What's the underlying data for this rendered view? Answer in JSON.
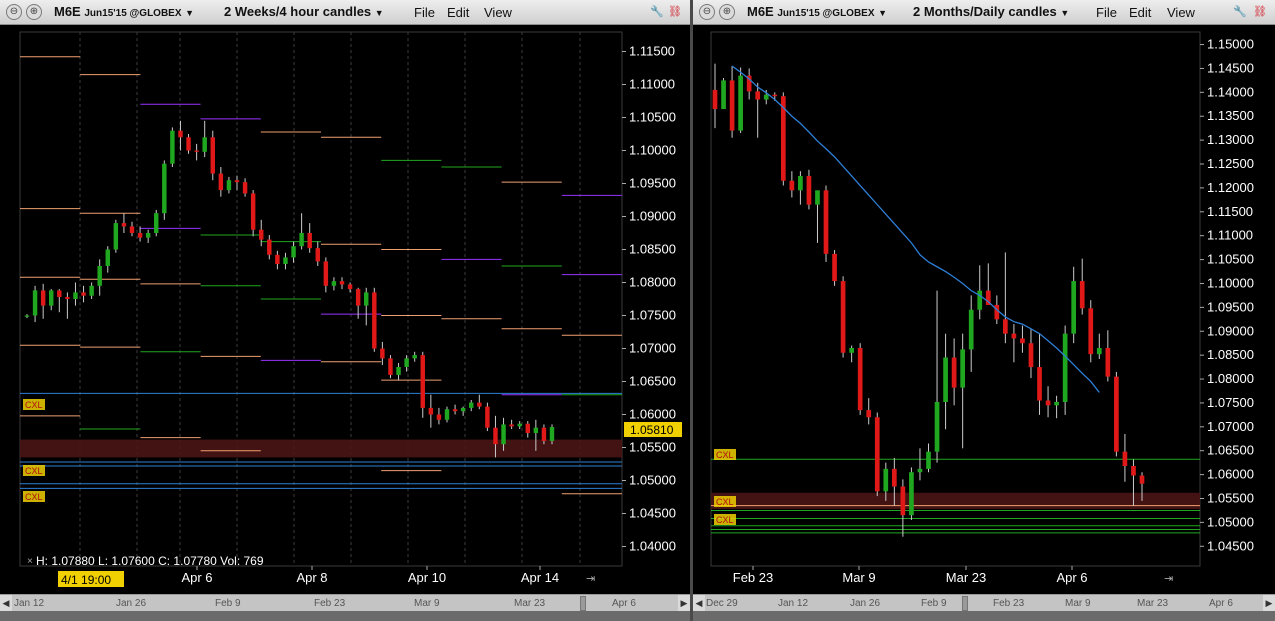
{
  "left": {
    "symbol": "M6E",
    "contract": "Jun15'15 @GLOBEX",
    "timeframe": "2 Weeks/4 hour candles",
    "menu": [
      "File",
      "Edit",
      "View"
    ],
    "price_labels": [
      "1.11500",
      "1.11000",
      "1.10500",
      "1.10000",
      "1.09500",
      "1.09000",
      "1.08500",
      "1.08000",
      "1.07500",
      "1.07000",
      "1.06500",
      "1.06000",
      "1.05500",
      "1.05000",
      "1.04500",
      "1.04000"
    ],
    "current_price": "1.05810",
    "date_labels": [
      "Apr 6",
      "Apr 8",
      "Apr 10",
      "Apr 14"
    ],
    "cursor_date": "4/1 19:00",
    "hlcv": "H: 1.07880   L: 1.07600   C: 1.07780   Vol: 769",
    "cxl": [
      "CXL",
      "CXL",
      "CXL"
    ],
    "scroll_labels": [
      "Jan 12",
      "Jan 26",
      "Feb 9",
      "Feb 23",
      "Mar 9",
      "Mar 23",
      "Apr 6"
    ]
  },
  "right": {
    "symbol": "M6E",
    "contract": "Jun15'15 @GLOBEX",
    "timeframe": "2 Months/Daily candles",
    "menu": [
      "File",
      "Edit",
      "View"
    ],
    "price_labels": [
      "1.15000",
      "1.14500",
      "1.14000",
      "1.13500",
      "1.13000",
      "1.12500",
      "1.12000",
      "1.11500",
      "1.11000",
      "1.10500",
      "1.10000",
      "1.09500",
      "1.09000",
      "1.08500",
      "1.08000",
      "1.07500",
      "1.07000",
      "1.06500",
      "1.06000",
      "1.05500",
      "1.05000",
      "1.04500"
    ],
    "date_labels": [
      "Feb 23",
      "Mar 9",
      "Mar 23",
      "Apr 6"
    ],
    "cxl": [
      "CXL",
      "CXL",
      "CXL"
    ],
    "scroll_labels": [
      "Dec 29",
      "Jan 12",
      "Jan 26",
      "Feb 9",
      "Feb 23",
      "Mar 9",
      "Mar 23",
      "Apr 6"
    ]
  },
  "colors": {
    "up": "#1fa81f",
    "down": "#e01818",
    "moving_average": "#2e7fd6",
    "accent": "#f0d000",
    "background": "#000000"
  },
  "chart_data": [
    {
      "type": "candlestick",
      "title": "M6E Jun15'15 @GLOBEX 2 Weeks/4 hour candles",
      "ylim": [
        1.0375,
        1.1175
      ],
      "x_tick_labels": [
        "Apr 6",
        "Apr 8",
        "Apr 10",
        "Apr 14"
      ],
      "last_price": 1.0581,
      "candles": [
        [
          1.0748,
          1.0752,
          1.0746,
          1.075
        ],
        [
          1.075,
          1.0795,
          1.074,
          1.0788
        ],
        [
          1.0788,
          1.0798,
          1.0745,
          1.0765
        ],
        [
          1.0765,
          1.079,
          1.0758,
          1.0788
        ],
        [
          1.0788,
          1.079,
          1.0755,
          1.0778
        ],
        [
          1.0778,
          1.0785,
          1.0745,
          1.0775
        ],
        [
          1.0775,
          1.08,
          1.0765,
          1.0785
        ],
        [
          1.0785,
          1.0795,
          1.077,
          1.078
        ],
        [
          1.078,
          1.08,
          1.0775,
          1.0795
        ],
        [
          1.0795,
          1.0835,
          1.078,
          1.0825
        ],
        [
          1.0825,
          1.0855,
          1.0815,
          1.085
        ],
        [
          1.085,
          1.0895,
          1.0845,
          1.089
        ],
        [
          1.089,
          1.0905,
          1.0875,
          1.0885
        ],
        [
          1.0885,
          1.0892,
          1.087,
          1.0875
        ],
        [
          1.0875,
          1.0885,
          1.0862,
          1.0868
        ],
        [
          1.0868,
          1.088,
          1.086,
          1.0875
        ],
        [
          1.0875,
          1.091,
          1.087,
          1.0905
        ],
        [
          1.0905,
          1.0985,
          1.0895,
          1.098
        ],
        [
          1.098,
          1.1035,
          1.0975,
          1.103
        ],
        [
          1.103,
          1.1045,
          1.1,
          1.102
        ],
        [
          1.102,
          1.1025,
          1.0995,
          1.1
        ],
        [
          1.1,
          1.101,
          1.0985,
          1.0998
        ],
        [
          1.0998,
          1.1045,
          1.099,
          1.102
        ],
        [
          1.102,
          1.103,
          1.0955,
          1.0965
        ],
        [
          1.0965,
          1.0975,
          1.093,
          1.094
        ],
        [
          1.094,
          1.096,
          1.0935,
          1.0955
        ],
        [
          1.0955,
          1.0962,
          1.094,
          1.0952
        ],
        [
          1.0952,
          1.0958,
          1.093,
          1.0935
        ],
        [
          1.0935,
          1.094,
          1.087,
          1.088
        ],
        [
          1.088,
          1.0895,
          1.0855,
          1.0865
        ],
        [
          1.0865,
          1.0872,
          1.0835,
          1.0842
        ],
        [
          1.0842,
          1.0848,
          1.082,
          1.0828
        ],
        [
          1.0828,
          1.0845,
          1.082,
          1.0838
        ],
        [
          1.0838,
          1.0862,
          1.083,
          1.0855
        ],
        [
          1.0855,
          1.0905,
          1.085,
          1.0875
        ],
        [
          1.0875,
          1.089,
          1.0845,
          1.0852
        ],
        [
          1.0852,
          1.0862,
          1.0825,
          1.0832
        ],
        [
          1.0832,
          1.0838,
          1.0785,
          1.0795
        ],
        [
          1.0795,
          1.0808,
          1.0788,
          1.0802
        ],
        [
          1.0802,
          1.0808,
          1.079,
          1.0797
        ],
        [
          1.0797,
          1.08,
          1.0785,
          1.079
        ],
        [
          1.079,
          1.0792,
          1.0745,
          1.0765
        ],
        [
          1.0765,
          1.0792,
          1.0735,
          1.0785
        ],
        [
          1.0785,
          1.0792,
          1.0695,
          1.07
        ],
        [
          1.07,
          1.071,
          1.0675,
          1.0685
        ],
        [
          1.0685,
          1.069,
          1.0655,
          1.066
        ],
        [
          1.066,
          1.0678,
          1.0652,
          1.0672
        ],
        [
          1.0672,
          1.069,
          1.0665,
          1.0685
        ],
        [
          1.0685,
          1.0695,
          1.068,
          1.069
        ],
        [
          1.069,
          1.0695,
          1.0595,
          1.061
        ],
        [
          1.061,
          1.063,
          1.058,
          1.06
        ],
        [
          1.06,
          1.061,
          1.0585,
          1.0592
        ],
        [
          1.0592,
          1.0612,
          1.0588,
          1.0608
        ],
        [
          1.0608,
          1.0615,
          1.06,
          1.0605
        ],
        [
          1.0605,
          1.0612,
          1.0598,
          1.061
        ],
        [
          1.061,
          1.0622,
          1.0605,
          1.0618
        ],
        [
          1.0618,
          1.063,
          1.0608,
          1.0612
        ],
        [
          1.0612,
          1.0618,
          1.0575,
          1.058
        ],
        [
          1.058,
          1.0598,
          1.0535,
          1.0555
        ],
        [
          1.0555,
          1.0595,
          1.0545,
          1.0585
        ],
        [
          1.0585,
          1.0592,
          1.0578,
          1.0582
        ],
        [
          1.0582,
          1.059,
          1.0578,
          1.0586
        ],
        [
          1.0586,
          1.059,
          1.0565,
          1.0572
        ],
        [
          1.0572,
          1.0592,
          1.0545,
          1.058
        ],
        [
          1.058,
          1.0585,
          1.0555,
          1.056
        ],
        [
          1.056,
          1.0585,
          1.0555,
          1.0581
        ]
      ],
      "level_lines": [
        {
          "price": 1.1142,
          "color": "#f0a070"
        },
        {
          "price": 1.1115,
          "color": "#f0a070"
        },
        {
          "price": 1.107,
          "color": "#9933ff"
        },
        {
          "price": 1.1048,
          "color": "#9933ff"
        },
        {
          "price": 1.1028,
          "color": "#f0a070"
        },
        {
          "price": 1.102,
          "color": "#f0a070"
        },
        {
          "price": 1.0985,
          "color": "#1fa81f"
        },
        {
          "price": 1.0975,
          "color": "#1fa81f"
        },
        {
          "price": 1.0952,
          "color": "#f0a070"
        },
        {
          "price": 1.0932,
          "color": "#9933ff"
        },
        {
          "price": 1.0912,
          "color": "#f0a070"
        },
        {
          "price": 1.0905,
          "color": "#f0a070"
        },
        {
          "price": 1.0882,
          "color": "#9933ff"
        },
        {
          "price": 1.0872,
          "color": "#1fa81f"
        },
        {
          "price": 1.0862,
          "color": "#1fa81f"
        },
        {
          "price": 1.0858,
          "color": "#f0a070"
        },
        {
          "price": 1.085,
          "color": "#f0a070"
        },
        {
          "price": 1.0835,
          "color": "#9933ff"
        },
        {
          "price": 1.0825,
          "color": "#1fa81f"
        },
        {
          "price": 1.0812,
          "color": "#9933ff"
        },
        {
          "price": 1.0808,
          "color": "#f0a070"
        },
        {
          "price": 1.0805,
          "color": "#f0a070"
        },
        {
          "price": 1.0798,
          "color": "#f0a070"
        },
        {
          "price": 1.0795,
          "color": "#1fa81f"
        },
        {
          "price": 1.0775,
          "color": "#1fa81f"
        },
        {
          "price": 1.0752,
          "color": "#9933ff"
        },
        {
          "price": 1.075,
          "color": "#f0a070"
        },
        {
          "price": 1.0745,
          "color": "#f0a070"
        },
        {
          "price": 1.073,
          "color": "#f0a070"
        },
        {
          "price": 1.072,
          "color": "#f0a070"
        },
        {
          "price": 1.0705,
          "color": "#f0a070"
        },
        {
          "price": 1.0702,
          "color": "#f0a070"
        },
        {
          "price": 1.0695,
          "color": "#1fa81f"
        },
        {
          "price": 1.0688,
          "color": "#f0a070"
        },
        {
          "price": 1.0682,
          "color": "#9933ff"
        },
        {
          "price": 1.068,
          "color": "#f0a070"
        },
        {
          "price": 1.0652,
          "color": "#f0a070"
        },
        {
          "price": 1.0632,
          "color": "#2e7fd6"
        },
        {
          "price": 1.063,
          "color": "#9933ff"
        },
        {
          "price": 1.063,
          "color": "#1fa81f"
        },
        {
          "price": 1.0598,
          "color": "#f0a070"
        },
        {
          "price": 1.0578,
          "color": "#1fa81f"
        },
        {
          "price": 1.0565,
          "color": "#f0a070"
        },
        {
          "price": 1.0545,
          "color": "#f0a070"
        },
        {
          "price": 1.0528,
          "color": "#2e7fd6"
        },
        {
          "price": 1.0522,
          "color": "#2e7fd6"
        },
        {
          "price": 1.0515,
          "color": "#f0a070"
        },
        {
          "price": 1.0495,
          "color": "#2e7fd6"
        },
        {
          "price": 1.0488,
          "color": "#2e7fd6"
        },
        {
          "price": 1.048,
          "color": "#f0a070"
        }
      ],
      "zone": [
        1.0535,
        1.0562
      ]
    },
    {
      "type": "candlestick",
      "title": "M6E Jun15'15 @GLOBEX 2 Months/Daily candles",
      "ylim": [
        1.0415,
        1.152
      ],
      "x_tick_labels": [
        "Feb 23",
        "Mar 9",
        "Mar 23",
        "Apr 6"
      ],
      "candles": [
        [
          1.1405,
          1.146,
          1.1325,
          1.1365
        ],
        [
          1.1365,
          1.143,
          1.1365,
          1.1425
        ],
        [
          1.1425,
          1.1455,
          1.1305,
          1.132
        ],
        [
          1.132,
          1.1452,
          1.1315,
          1.1435
        ],
        [
          1.1435,
          1.145,
          1.1385,
          1.1402
        ],
        [
          1.1402,
          1.142,
          1.1305,
          1.1385
        ],
        [
          1.1385,
          1.1405,
          1.1375,
          1.1395
        ],
        [
          1.1395,
          1.14,
          1.1382,
          1.1392
        ],
        [
          1.1392,
          1.14,
          1.1205,
          1.1215
        ],
        [
          1.1215,
          1.1235,
          1.118,
          1.1195
        ],
        [
          1.1195,
          1.1235,
          1.1165,
          1.1225
        ],
        [
          1.1225,
          1.1238,
          1.1155,
          1.1165
        ],
        [
          1.1165,
          1.119,
          1.1085,
          1.1195
        ],
        [
          1.1195,
          1.1205,
          1.1045,
          1.1062
        ],
        [
          1.1062,
          1.107,
          1.0995,
          1.1005
        ],
        [
          1.1005,
          1.1015,
          1.0845,
          1.0855
        ],
        [
          1.0855,
          1.087,
          1.0835,
          1.0865
        ],
        [
          1.0865,
          1.0875,
          1.0725,
          1.0735
        ],
        [
          1.0735,
          1.076,
          1.0705,
          1.072
        ],
        [
          1.072,
          1.073,
          1.0555,
          1.0565
        ],
        [
          1.0565,
          1.0625,
          1.0545,
          1.0612
        ],
        [
          1.0612,
          1.0635,
          1.0535,
          1.0575
        ],
        [
          1.0575,
          1.059,
          1.047,
          1.0515
        ],
        [
          1.0515,
          1.0615,
          1.0505,
          1.0605
        ],
        [
          1.0605,
          1.0655,
          1.0588,
          1.0612
        ],
        [
          1.0612,
          1.0665,
          1.0605,
          1.0648
        ],
        [
          1.0648,
          1.0985,
          1.0625,
          1.0752
        ],
        [
          1.0752,
          1.0895,
          1.0695,
          1.0845
        ],
        [
          1.0845,
          1.0885,
          1.0745,
          1.0782
        ],
        [
          1.0782,
          1.0895,
          1.0655,
          1.0862
        ],
        [
          1.0862,
          1.0975,
          1.0815,
          1.0945
        ],
        [
          1.0945,
          1.1038,
          1.0925,
          1.0985
        ],
        [
          1.0985,
          1.1042,
          1.0965,
          1.0955
        ],
        [
          1.0955,
          1.0975,
          1.0915,
          1.0925
        ],
        [
          1.0925,
          1.1065,
          1.0875,
          1.0895
        ],
        [
          1.0895,
          1.0915,
          1.0835,
          1.0885
        ],
        [
          1.0885,
          1.0912,
          1.0855,
          1.0875
        ],
        [
          1.0875,
          1.0905,
          1.0802,
          1.0825
        ],
        [
          1.0825,
          1.0895,
          1.0725,
          1.0755
        ],
        [
          1.0755,
          1.0785,
          1.072,
          1.0745
        ],
        [
          1.0745,
          1.0765,
          1.0718,
          1.0752
        ],
        [
          1.0752,
          1.0912,
          1.0725,
          1.0895
        ],
        [
          1.0895,
          1.1035,
          1.0875,
          1.1005
        ],
        [
          1.1005,
          1.1052,
          1.0935,
          1.0948
        ],
        [
          1.0948,
          1.0965,
          1.0835,
          1.0852
        ],
        [
          1.0852,
          1.0895,
          1.0842,
          1.0865
        ],
        [
          1.0865,
          1.0902,
          1.0795,
          1.0805
        ],
        [
          1.0805,
          1.0815,
          1.0638,
          1.0648
        ],
        [
          1.0648,
          1.0685,
          1.0585,
          1.0618
        ],
        [
          1.0618,
          1.0632,
          1.0535,
          1.0598
        ],
        [
          1.0598,
          1.0605,
          1.0545,
          1.0581
        ]
      ],
      "moving_average": [
        1.1455,
        1.1442,
        1.1428,
        1.1411,
        1.1399,
        1.1385,
        1.1368,
        1.135,
        1.1335,
        1.1317,
        1.1298,
        1.1282,
        1.1265,
        1.1245,
        1.1225,
        1.1205,
        1.1185,
        1.1165,
        1.1145,
        1.1125,
        1.1105,
        1.1085,
        1.106,
        1.1045,
        1.1035,
        1.1025,
        1.1013,
        1.1,
        1.0985,
        1.0975,
        1.0962,
        1.0945,
        1.093,
        1.092,
        1.0915,
        1.0905,
        1.0895,
        1.088,
        1.0865,
        1.0848,
        1.083,
        1.0812,
        1.0795,
        1.0772
      ],
      "level_lines": [
        {
          "price": 1.0632,
          "color": "#1fa81f"
        },
        {
          "price": 1.0535,
          "color": "#f0a070"
        },
        {
          "price": 1.0525,
          "color": "#1fa81f"
        },
        {
          "price": 1.0508,
          "color": "#1fa81f"
        },
        {
          "price": 1.0493,
          "color": "#1fa81f"
        },
        {
          "price": 1.0485,
          "color": "#1fa81f"
        },
        {
          "price": 1.0478,
          "color": "#1fa81f"
        }
      ],
      "zone": [
        1.0528,
        1.0562
      ]
    }
  ]
}
